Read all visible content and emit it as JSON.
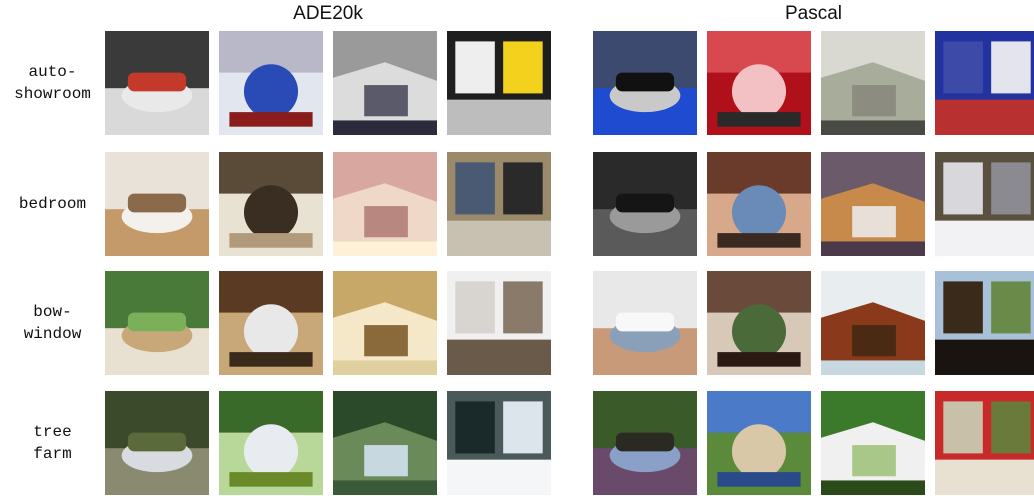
{
  "groups": [
    {
      "title": "ADE20k"
    },
    {
      "title": "Pascal"
    }
  ],
  "rows": [
    {
      "label": "auto-\nshowroom",
      "images": [
        {
          "scene": "white car in showroom",
          "palette": [
            "#3a3a3a",
            "#d9d9d9",
            "#e9e9e9",
            "#c43a2a"
          ]
        },
        {
          "scene": "blue convertible showroom",
          "palette": [
            "#b8b8c8",
            "#e2e6ee",
            "#2a4bb5",
            "#8a1c1c"
          ]
        },
        {
          "scene": "cars in showroom",
          "palette": [
            "#9a9a9a",
            "#dcdcdc",
            "#5a5a6a",
            "#2b2b3d"
          ]
        },
        {
          "scene": "yellow motorcycle",
          "palette": [
            "#eeeeee",
            "#f2d21c",
            "#1e1e1e",
            "#bdbdbd"
          ]
        },
        {
          "scene": "blue subaru",
          "palette": [
            "#3b4a6e",
            "#1f4bd1",
            "#c9c9c9",
            "#111111"
          ]
        },
        {
          "scene": "red motorcycle",
          "palette": [
            "#d8484f",
            "#b0101a",
            "#f3c0c4",
            "#2a2a2a"
          ]
        },
        {
          "scene": "vintage car",
          "palette": [
            "#d9d9d2",
            "#a7ad9a",
            "#8c8c80",
            "#4a4a44"
          ]
        },
        {
          "scene": "blue race car",
          "palette": [
            "#3d4aa8",
            "#e4e4ee",
            "#2233a0",
            "#b83030"
          ]
        }
      ]
    },
    {
      "label": "bedroom",
      "images": [
        {
          "scene": "white bedroom",
          "palette": [
            "#e8e2d8",
            "#c49a6a",
            "#f4f1ec",
            "#8a6a4a"
          ]
        },
        {
          "scene": "dark bedroom",
          "palette": [
            "#5a4a38",
            "#e8e2d2",
            "#3a2e22",
            "#b09a7a"
          ]
        },
        {
          "scene": "pink lit bedroom",
          "palette": [
            "#d8a8a0",
            "#f0d8c8",
            "#b88880",
            "#fff0d8"
          ]
        },
        {
          "scene": "blue wall bedroom",
          "palette": [
            "#4a5a72",
            "#2a2a2a",
            "#9a8a6a",
            "#c8c0b0"
          ]
        },
        {
          "scene": "person in dark",
          "palette": [
            "#2a2a2a",
            "#5a5a5a",
            "#9a9a9a",
            "#151515"
          ]
        },
        {
          "scene": "baby on bed",
          "palette": [
            "#6a3a2a",
            "#d8a88a",
            "#6a8ab8",
            "#3a2a22"
          ]
        },
        {
          "scene": "cat on bed",
          "palette": [
            "#6a5a6a",
            "#c88a4a",
            "#e8e0d8",
            "#4a3a4a"
          ]
        },
        {
          "scene": "cat on pillows",
          "palette": [
            "#d8d8dc",
            "#8a8a90",
            "#5a5040",
            "#f2f2f4"
          ]
        }
      ]
    },
    {
      "label": "bow-\nwindow",
      "images": [
        {
          "scene": "garden window",
          "palette": [
            "#4a7a3a",
            "#e8e0d0",
            "#c8a878",
            "#7ab05a"
          ]
        },
        {
          "scene": "living room window",
          "palette": [
            "#5a3a22",
            "#c8a878",
            "#e8e8e8",
            "#3a2a1a"
          ]
        },
        {
          "scene": "bright bow window",
          "palette": [
            "#c8a868",
            "#f4e8c8",
            "#8a6a3a",
            "#e0d0a0"
          ]
        },
        {
          "scene": "white living room",
          "palette": [
            "#d8d4d0",
            "#8a7a6a",
            "#f0f0f0",
            "#6a5a4a"
          ]
        },
        {
          "scene": "cat at window",
          "palette": [
            "#e8e8e8",
            "#c89a7a",
            "#8aa0b8",
            "#f8f8f8"
          ]
        },
        {
          "scene": "plant at window",
          "palette": [
            "#6a4a3a",
            "#d8c8b8",
            "#4a6a3a",
            "#2a1a12"
          ]
        },
        {
          "scene": "dog at window",
          "palette": [
            "#e8eef0",
            "#8a3a1a",
            "#4a2a12",
            "#c8d8e0"
          ]
        },
        {
          "scene": "cat in window frame",
          "palette": [
            "#3a2a1a",
            "#6a8a4a",
            "#a8c0d8",
            "#1a1410"
          ]
        }
      ]
    },
    {
      "label": "tree\nfarm",
      "images": [
        {
          "scene": "rocky trees",
          "palette": [
            "#3a4a2a",
            "#8a8a70",
            "#d8dce0",
            "#5a6a3a"
          ]
        },
        {
          "scene": "hedge rows",
          "palette": [
            "#3a6a2a",
            "#b8d89a",
            "#e8ecf0",
            "#6a8a2a"
          ]
        },
        {
          "scene": "forest hillside",
          "palette": [
            "#2a4a2a",
            "#6a8a5a",
            "#c8d8e0",
            "#3a5a3a"
          ]
        },
        {
          "scene": "snowy pines",
          "palette": [
            "#1a2a2a",
            "#dce4ec",
            "#4a5a5a",
            "#f4f6f8"
          ]
        },
        {
          "scene": "person on trail",
          "palette": [
            "#3a5a2a",
            "#6a4a6a",
            "#8aa0c8",
            "#2a2a22"
          ]
        },
        {
          "scene": "people by water",
          "palette": [
            "#4a7ac8",
            "#5a8a3a",
            "#d8c8a8",
            "#2a4a8a"
          ]
        },
        {
          "scene": "group in garden",
          "palette": [
            "#3a7a2a",
            "#f0f0f0",
            "#a8c88a",
            "#2a4a1a"
          ]
        },
        {
          "scene": "motocross jump",
          "palette": [
            "#c8c0a8",
            "#6a7a3a",
            "#c82a2a",
            "#e8e0d0"
          ]
        }
      ]
    }
  ]
}
